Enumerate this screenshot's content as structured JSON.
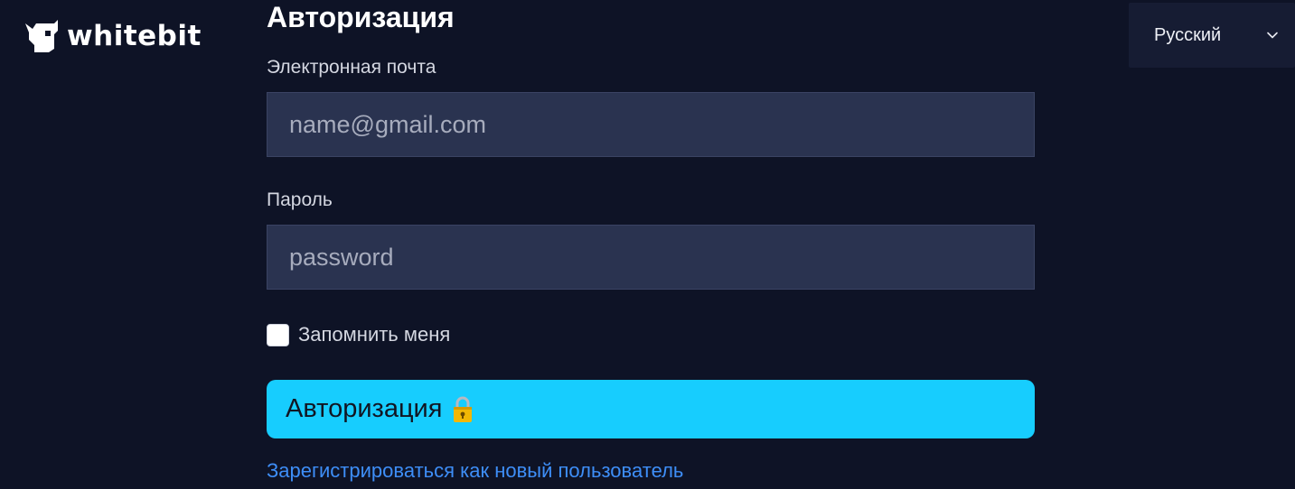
{
  "brand": {
    "name": "whitebit",
    "logo_icon": "bull-head-icon"
  },
  "language": {
    "selected": "Русский",
    "icon": "chevron-down-icon"
  },
  "login_form": {
    "title": "Авторизация",
    "email": {
      "label": "Электронная почта",
      "value": "",
      "placeholder": "name@gmail.com"
    },
    "password": {
      "label": "Пароль",
      "value": "",
      "placeholder": "password"
    },
    "remember_me": {
      "label": "Запомнить меня",
      "checked": false
    },
    "submit": {
      "label": "Авторизация",
      "icon": "lock-icon"
    },
    "register_link": "Зарегистрироваться как новый пользователь"
  },
  "colors": {
    "background": "#0e1326",
    "input_background": "#2a3350",
    "accent_button": "#17cdfe",
    "link": "#3e8ef7"
  }
}
